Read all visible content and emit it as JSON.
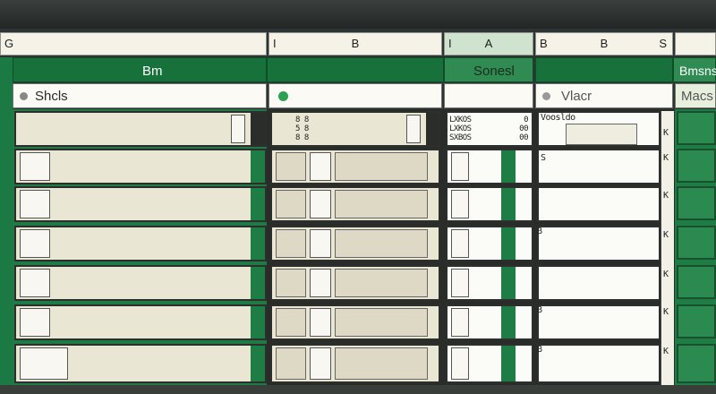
{
  "column_headers": {
    "col1_left": "G",
    "col2_left": "I",
    "col2_center": "B",
    "col3_left": "I",
    "col3_right": "A",
    "col4_left": "B",
    "col4_center": "B",
    "col4_right": "S"
  },
  "band": {
    "col1": "Bm",
    "col3": "Sonesl",
    "col5": "Bmsns"
  },
  "subheader": {
    "col1": "Shcls",
    "col4": "Vlacr",
    "col5": "Macs"
  },
  "cells": {
    "col2_lines": [
      "8 8",
      "5 8",
      "8 8"
    ],
    "col3_left_lines": [
      "LXKOS",
      "LXKOS",
      "SXBOS"
    ],
    "col3_right_lines": [
      "0",
      "00",
      "00"
    ],
    "col4_label": "Voosldo",
    "col4_marks": [
      "S",
      "B",
      "B",
      "B"
    ],
    "scroll_marks": [
      "K",
      "K",
      "K",
      "K",
      "K",
      "K",
      "K"
    ]
  },
  "colors": {
    "green_dark": "#16713a",
    "green_light": "#2f8b52",
    "cell_beige": "#eae6d4",
    "header_cream": "#f5f2e8"
  }
}
